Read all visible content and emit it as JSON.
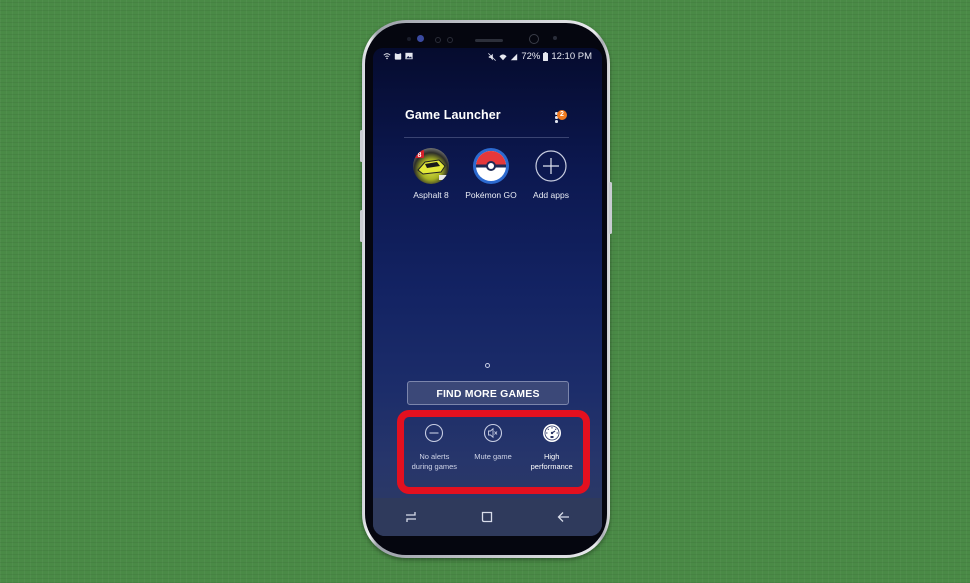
{
  "background": {
    "color": "#4a8a46"
  },
  "statusbar": {
    "left_icons": [
      "wifi-call-icon",
      "clipboard-icon",
      "gallery-icon"
    ],
    "right_icons": [
      "mute-icon",
      "wifi-icon",
      "signal-icon"
    ],
    "battery": "72%",
    "battery_icon": "battery-icon",
    "time": "12:10 PM"
  },
  "header": {
    "title": "Game Launcher",
    "menu_icon": "more-vert-icon",
    "badge_count": "2",
    "badge_color": "#f07a1f"
  },
  "apps": [
    {
      "label": "Asphalt 8",
      "icon": "asphalt-8-icon"
    },
    {
      "label": "Pokémon GO",
      "icon": "pokemon-go-icon"
    },
    {
      "label": "Add apps",
      "icon": "plus-circle-icon"
    }
  ],
  "page_indicator": {
    "current": 1,
    "total": 1
  },
  "find_more_button": {
    "label": "FIND MORE GAMES"
  },
  "highlight": {
    "color": "#e3101f"
  },
  "quick_settings": [
    {
      "label_line1": "No alerts",
      "label_line2": "during games",
      "icon": "no-alerts-icon",
      "active": false
    },
    {
      "label_line1": "Mute game",
      "label_line2": "",
      "icon": "mute-game-icon",
      "active": false
    },
    {
      "label_line1": "High",
      "label_line2": "performance",
      "icon": "speedometer-icon",
      "active": true
    }
  ],
  "navbar": {
    "recents_icon": "recents-icon",
    "home_icon": "home-icon",
    "back_icon": "back-icon"
  }
}
